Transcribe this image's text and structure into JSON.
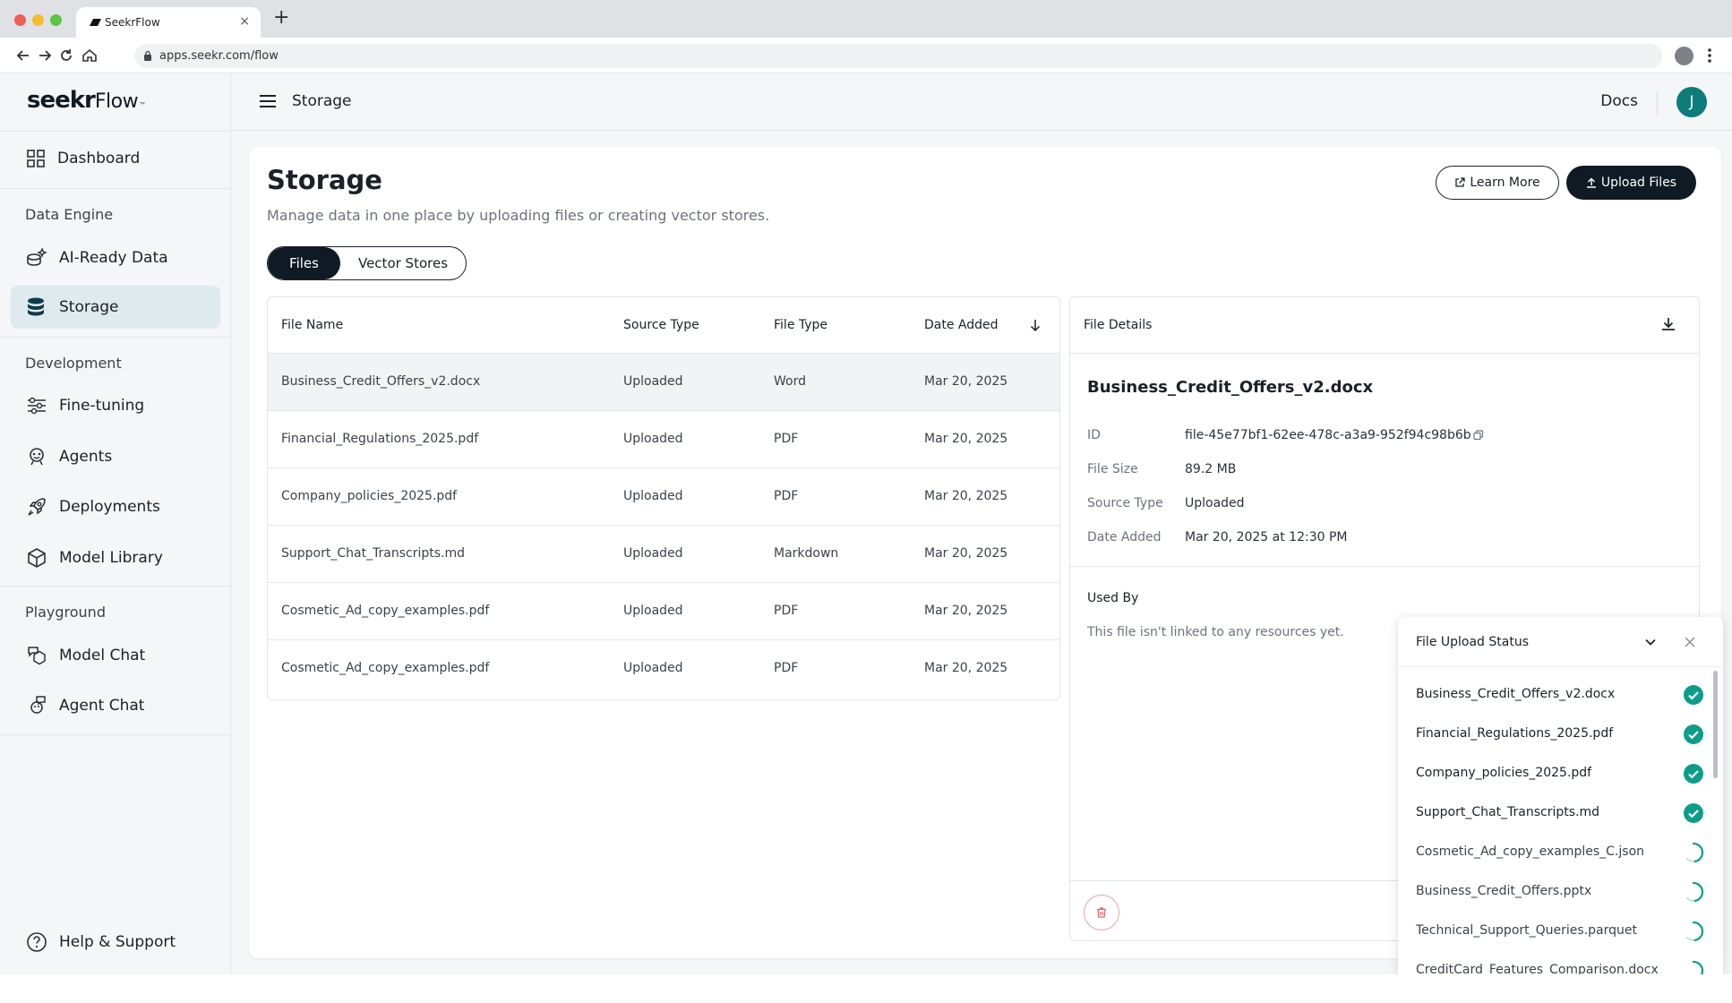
{
  "browser": {
    "tab_title": "SeekrFlow",
    "url": "apps.seekr.com/flow"
  },
  "brand": {
    "name_bold": "seekr",
    "name_light": "Flow",
    "trademark": "™"
  },
  "sidebar": {
    "dashboard": "Dashboard",
    "section_data_engine": "Data Engine",
    "ai_ready_data": "AI-Ready Data",
    "storage": "Storage",
    "section_development": "Development",
    "fine_tuning": "Fine-tuning",
    "agents": "Agents",
    "deployments": "Deployments",
    "model_library": "Model Library",
    "section_playground": "Playground",
    "model_chat": "Model Chat",
    "agent_chat": "Agent Chat",
    "help": "Help & Support"
  },
  "topbar": {
    "breadcrumb": "Storage",
    "docs": "Docs",
    "avatar_initial": "J"
  },
  "page": {
    "title": "Storage",
    "subtitle": "Manage data in one place by uploading files or creating vector stores.",
    "learn_more": "Learn More",
    "upload_files": "Upload Files",
    "tabs": [
      "Files",
      "Vector Stores"
    ],
    "active_tab": "Files"
  },
  "table": {
    "headers": [
      "File Name",
      "Source Type",
      "File Type",
      "Date Added"
    ],
    "sort_column": "Date Added",
    "rows": [
      {
        "name": "Business_Credit_Offers_v2.docx",
        "source": "Uploaded",
        "type": "Word",
        "date": "Mar 20, 2025"
      },
      {
        "name": "Financial_Regulations_2025.pdf",
        "source": "Uploaded",
        "type": "PDF",
        "date": "Mar 20, 2025"
      },
      {
        "name": "Company_policies_2025.pdf",
        "source": "Uploaded",
        "type": "PDF",
        "date": "Mar 20, 2025"
      },
      {
        "name": "Support_Chat_Transcripts.md",
        "source": "Uploaded",
        "type": "Markdown",
        "date": "Mar 20, 2025"
      },
      {
        "name": "Cosmetic_Ad_copy_examples.pdf",
        "source": "Uploaded",
        "type": "PDF",
        "date": "Mar 20, 2025"
      },
      {
        "name": "Cosmetic_Ad_copy_examples.pdf",
        "source": "Uploaded",
        "type": "PDF",
        "date": "Mar 20, 2025"
      }
    ]
  },
  "details": {
    "header": "File Details",
    "file_name": "Business_Credit_Offers_v2.docx",
    "id_label": "ID",
    "id_value": "file-45e77bf1-62ee-478c-a3a9-952f94c98b6b",
    "size_label": "File Size",
    "size_value": "89.2 MB",
    "source_label": "Source Type",
    "source_value": "Uploaded",
    "date_label": "Date Added",
    "date_value": "Mar 20, 2025 at 12:30 PM",
    "used_by_label": "Used By",
    "used_by_empty": "This file isn't linked to any resources yet."
  },
  "upload_status": {
    "title": "File Upload Status",
    "files": [
      {
        "name": "Business_Credit_Offers_v2.docx",
        "status": "complete"
      },
      {
        "name": "Financial_Regulations_2025.pdf",
        "status": "complete"
      },
      {
        "name": "Company_policies_2025.pdf",
        "status": "complete"
      },
      {
        "name": "Support_Chat_Transcripts.md",
        "status": "complete"
      },
      {
        "name": "Cosmetic_Ad_copy_examples_C.json",
        "status": "uploading"
      },
      {
        "name": "Business_Credit_Offers.pptx",
        "status": "uploading"
      },
      {
        "name": "Technical_Support_Queries.parquet",
        "status": "uploading"
      },
      {
        "name": "CreditCard_Features_Comparison.docx",
        "status": "uploading"
      }
    ]
  },
  "colors": {
    "accent_teal": "#0e9c8a",
    "primary_dark": "#101a24",
    "danger": "#d46a6a"
  }
}
